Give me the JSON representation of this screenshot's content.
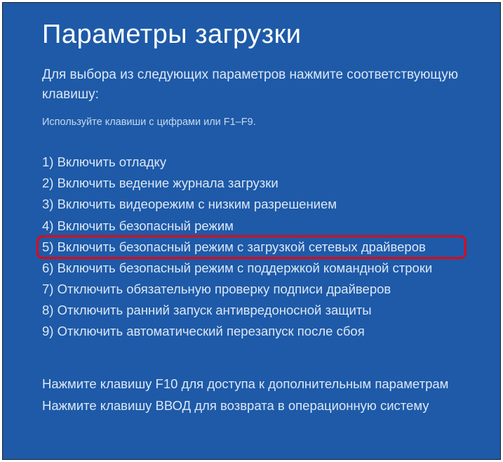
{
  "title": "Параметры загрузки",
  "instruction": "Для выбора из следующих параметров нажмите соответствующую клавишу:",
  "hint": "Используйте клавиши с цифрами или F1–F9.",
  "options": [
    "1) Включить отладку",
    "2) Включить ведение журнала загрузки",
    "3) Включить видеорежим с низким разрешением",
    "4) Включить безопасный режим",
    "5) Включить безопасный режим с загрузкой сетевых драйверов",
    "6) Включить безопасный режим с поддержкой командной строки",
    "7) Отключить обязательную проверку подписи драйверов",
    "8) Отключить ранний запуск антивредоносной защиты",
    "9) Отключить автоматический перезапуск после сбоя"
  ],
  "highlightIndex": 4,
  "footer": {
    "line1": "Нажмите клавишу F10 для доступа к дополнительным параметрам",
    "line2": "Нажмите клавишу ВВОД для возврата в операционную систему"
  },
  "colors": {
    "background": "#1e5aa8",
    "highlightBorder": "#e30613"
  }
}
